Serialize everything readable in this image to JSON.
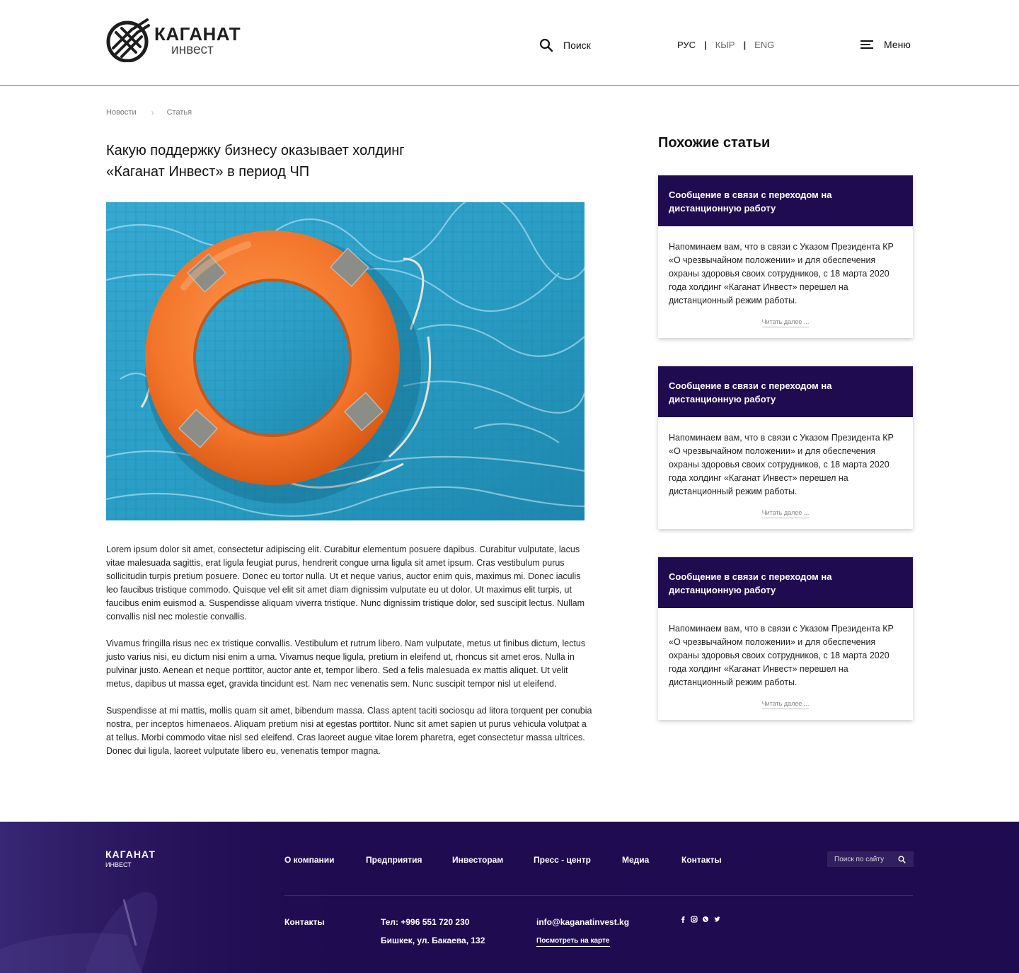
{
  "header": {
    "logo_title": "КАГАНАТ",
    "logo_sub": "инвест",
    "search_label": "Поиск",
    "languages": [
      "РУС",
      "КЫР",
      "ENG"
    ],
    "lang_separator": "|",
    "menu_label": "Меню"
  },
  "breadcrumb": {
    "items": [
      "Новости",
      "Статья"
    ],
    "separator": "›"
  },
  "article": {
    "title_line1": "Какую поддержку бизнесу оказывает холдинг",
    "title_line2": "«Каганат Инвест» в период ЧП",
    "paragraphs": [
      "Lorem ipsum dolor sit amet, consectetur adipiscing elit. Curabitur elementum posuere dapibus. Curabitur vulputate, lacus vitae malesuada sagittis, erat ligula feugiat purus, hendrerit congue urna ligula sit amet ipsum. Cras vestibulum purus sollicitudin turpis pretium posuere. Donec eu tortor nulla. Ut et neque varius, auctor enim quis, maximus mi. Donec iaculis leo faucibus tristique commodo. Quisque vel elit sit amet diam dignissim vulputate eu ut dolor. Ut maximus elit turpis, ut faucibus enim euismod a. Suspendisse aliquam viverra tristique. Nunc dignissim tristique dolor, sed suscipit lectus. Nullam convallis nisl nec molestie convallis.",
      "Vivamus fringilla risus nec ex tristique convallis. Vestibulum et rutrum libero. Nam vulputate, metus ut finibus dictum, lectus justo varius nisi, eu dictum nisi enim a urna. Vivamus neque ligula, pretium in eleifend ut, rhoncus sit amet eros. Nulla in pulvinar justo. Aenean et neque porttitor, auctor ante et, tempor libero. Sed a felis malesuada ex mattis aliquet. Ut velit metus, dapibus ut massa eget, gravida tincidunt est. Nam nec venenatis sem. Nunc suscipit tempor nisl ut eleifend.",
      "Suspendisse at mi mattis, mollis quam sit amet, bibendum massa. Class aptent taciti sociosqu ad litora torquent per conubia nostra, per inceptos himenaeos. Aliquam pretium nisi at egestas porttitor. Nunc sit amet sapien ut purus vehicula volutpat a at tellus. Morbi commodo vitae nisl sed eleifend. Cras laoreet augue vitae lorem pharetra, eget consectetur massa ultrices. Donec dui ligula, laoreet vulputate libero eu, venenatis tempor magna."
    ]
  },
  "sidebar": {
    "title": "Похожие статьи",
    "cards": [
      {
        "heading": "Сообщение в связи с переходом на дистанционную работу",
        "text": "Напоминаем вам, что в связи с Указом Президента КР «О чрезвычайном положении» и для обеспечения охраны здоровья своих сотрудников, с 18 марта 2020 года холдинг «Каганат Инвест» перешел на дистанционный режим работы.",
        "more": "Читать далее ..."
      },
      {
        "heading": "Сообщение в связи с переходом на дистанционную работу",
        "text": "Напоминаем вам, что в связи с Указом Президента КР «О чрезвычайном положении» и для обеспечения охраны здоровья своих сотрудников, с 18 марта 2020 года холдинг «Каганат Инвест» перешел на дистанционный режим работы.",
        "more": "Читать далее ..."
      },
      {
        "heading": "Сообщение в связи с переходом на дистанционную работу",
        "text": "Напоминаем вам, что в связи с Указом Президента КР «О чрезвычайном положении» и для обеспечения охраны здоровья своих сотрудников, с 18 марта 2020 года холдинг «Каганат Инвест» перешел на дистанционный режим работы.",
        "more": "Читать далее ..."
      }
    ]
  },
  "footer": {
    "logo_title": "КАГАНАТ",
    "logo_sub": "ИНВЕСТ",
    "nav": [
      "О компании",
      "Предприятия",
      "Инвесторам",
      "Пресс - центр",
      "Медиа",
      "Контакты"
    ],
    "search_placeholder": "Поиск по сайту",
    "contacts_label": "Контакты",
    "phone": "Тел: +996 551 720 230",
    "address": "Бишкек, ул. Бакаева, 132",
    "email": "info@kaganatinvest.kg",
    "map_link": "Посмотреть на карте",
    "socials": [
      "facebook-icon",
      "instagram-icon",
      "whatsapp-icon",
      "twitter-icon"
    ]
  },
  "colors": {
    "accent": "#1f0b4f",
    "lifebuoy": "#f2742a",
    "water": "#2a9ec4"
  }
}
